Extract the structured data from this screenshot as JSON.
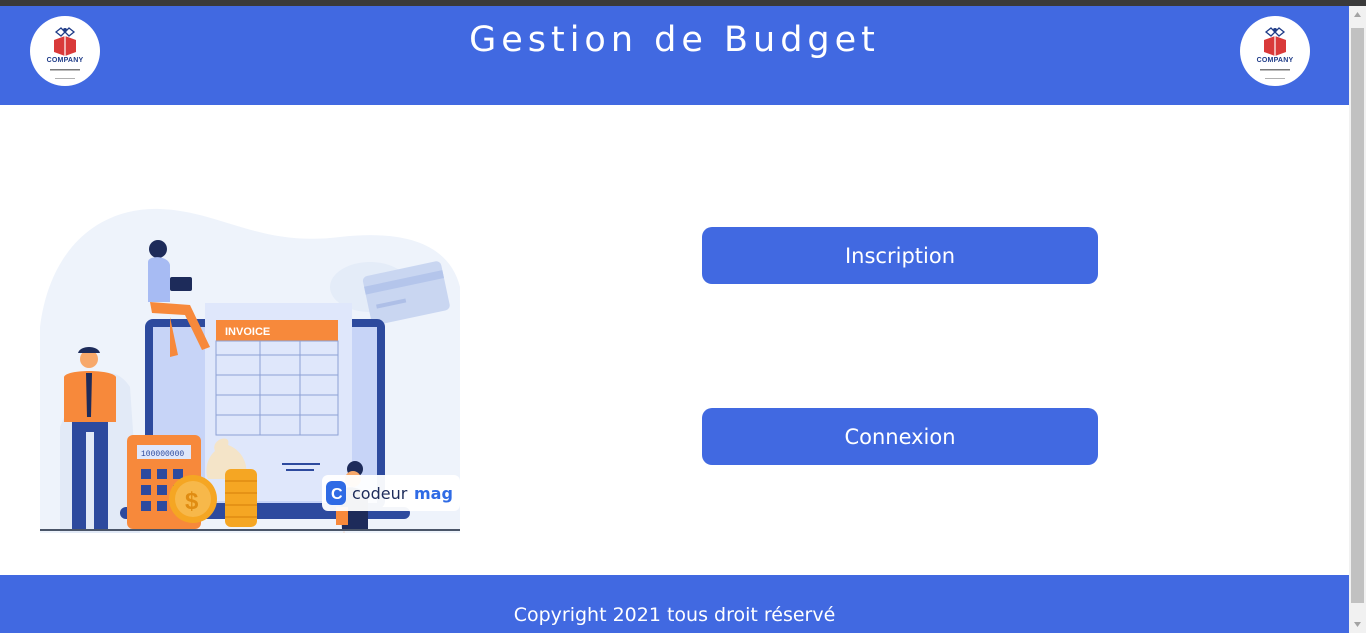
{
  "header": {
    "title": "Gestion de Budget",
    "logo_left": {
      "text": "COMPANY",
      "icon": "company-logo-icon"
    },
    "logo_right": {
      "text": "COMPANY",
      "icon": "company-logo-icon"
    }
  },
  "main": {
    "illustration": {
      "invoice_label": "INVOICE",
      "calculator_display": "100000000",
      "brand_text": "codeur",
      "brand_text_accent": "mag",
      "brand_icon_letter": "C"
    },
    "buttons": {
      "inscription": "Inscription",
      "connexion": "Connexion"
    }
  },
  "footer": {
    "copyright": "Copyright 2021 tous droit réservé"
  },
  "colors": {
    "primary": "#4169e1",
    "white": "#ffffff",
    "orange": "#f7893b",
    "navy": "#1f3c88"
  }
}
